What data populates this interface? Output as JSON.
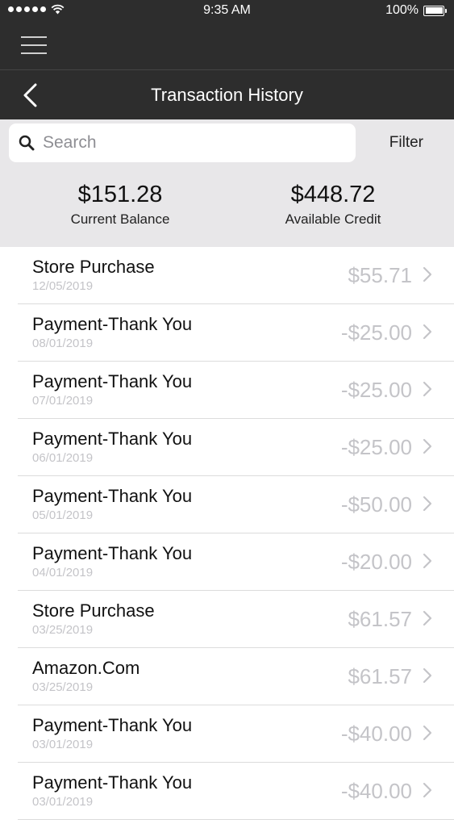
{
  "status_bar": {
    "time": "9:35 AM",
    "battery": "100%"
  },
  "nav": {
    "title": "Transaction History"
  },
  "search": {
    "placeholder": "Search",
    "filter_label": "Filter"
  },
  "summary": {
    "balance_amount": "$151.28",
    "balance_label": "Current Balance",
    "credit_amount": "$448.72",
    "credit_label": "Available Credit"
  },
  "transactions": [
    {
      "title": "Store Purchase",
      "date": "12/05/2019",
      "amount": "$55.71"
    },
    {
      "title": "Payment-Thank You",
      "date": "08/01/2019",
      "amount": "-$25.00"
    },
    {
      "title": "Payment-Thank You",
      "date": "07/01/2019",
      "amount": "-$25.00"
    },
    {
      "title": "Payment-Thank You",
      "date": "06/01/2019",
      "amount": "-$25.00"
    },
    {
      "title": "Payment-Thank You",
      "date": "05/01/2019",
      "amount": "-$50.00"
    },
    {
      "title": "Payment-Thank You",
      "date": "04/01/2019",
      "amount": "-$20.00"
    },
    {
      "title": "Store Purchase",
      "date": "03/25/2019",
      "amount": "$61.57"
    },
    {
      "title": "Amazon.Com",
      "date": "03/25/2019",
      "amount": "$61.57"
    },
    {
      "title": "Payment-Thank You",
      "date": "03/01/2019",
      "amount": "-$40.00"
    },
    {
      "title": "Payment-Thank You",
      "date": "03/01/2019",
      "amount": "-$40.00"
    }
  ],
  "icons": {
    "signal": "signal-dots-icon",
    "wifi": "wifi-icon",
    "battery": "battery-icon",
    "menu": "hamburger-menu-icon",
    "back": "chevron-left-icon",
    "search": "search-icon",
    "row": "chevron-right-icon"
  },
  "colors": {
    "header": "#2d2d2d",
    "summary_bg": "#e8e7e9",
    "muted": "#c4c4c8"
  }
}
